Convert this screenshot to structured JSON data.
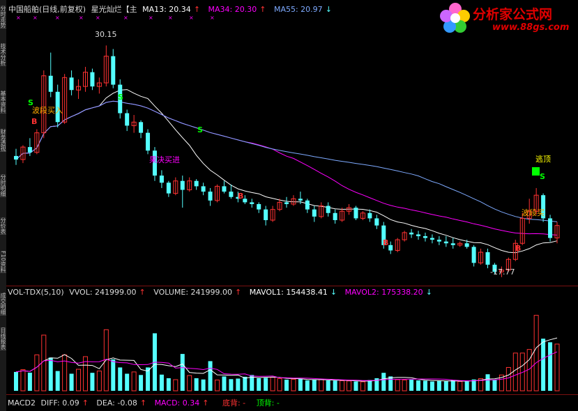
{
  "header": {
    "title": "中国船舶(日线,前复权)",
    "indicator": "星光灿烂【主",
    "ma13": "MA13: 20.34",
    "ma34": "MA34: 20.30",
    "ma55": "MA55: 20.97",
    "ma13_arrow": "↑",
    "ma34_arrow": "↑",
    "ma55_arrow": "↓"
  },
  "sidebar": {
    "tabs": [
      "分时走势",
      "技术分析",
      "基本资料",
      "财务透视",
      "分时明细",
      "分价表",
      "F10资料",
      "成交明细",
      "日线报表"
    ]
  },
  "annotations": {
    "high_price": "30.15",
    "low_price": "-17.77",
    "band_buy_1": "波段买入",
    "decisive_buy": "果决买进",
    "escape_top": "逃顶",
    "band_buy_2": "波段买",
    "s_label": "S",
    "b_label": "B"
  },
  "vol_header": {
    "name": "VOL-TDX(5,10)",
    "vvol": "VVOL: 241999.00",
    "vvol_arrow": "↑",
    "volume": "VOLUME: 241999.00",
    "volume_arrow": "↑",
    "mavol1": "MAVOL1: 154438.41",
    "mavol1_arrow": "↓",
    "mavol2": "MAVOL2: 175338.20",
    "mavol2_arrow": "↓"
  },
  "macd_header": {
    "name": "MACD2",
    "diff": "DIFF: 0.09",
    "diff_arrow": "↑",
    "dea": "DEA: -0.08",
    "dea_arrow": "↑",
    "macd": "MACD: 0.34",
    "macd_arrow": "↑",
    "bottom_div": "底背: -",
    "top_div": "顶背: -"
  },
  "logo": {
    "brand": "分析家公式网",
    "url": "www.88gs.com"
  },
  "colors": {
    "up": "#ff3232",
    "down": "#54ffff",
    "ma13": "#ffffff",
    "ma34": "#ff00ff",
    "ma55": "#7eaaff",
    "accent_yellow": "#ffff00",
    "accent_green": "#00ff00",
    "logo_red": "#e00000"
  },
  "chart_data": {
    "type": "candlestick",
    "price_range": [
      17.0,
      31.5
    ],
    "volume_range": [
      0,
      500000
    ],
    "candles": [
      [
        24.0,
        24.4,
        23.5,
        23.8
      ],
      [
        23.8,
        24.6,
        23.6,
        24.5
      ],
      [
        24.5,
        25.0,
        24.0,
        24.2
      ],
      [
        24.2,
        25.5,
        24.1,
        25.3
      ],
      [
        25.3,
        28.8,
        25.0,
        28.5
      ],
      [
        28.5,
        29.8,
        27.3,
        27.6
      ],
      [
        27.6,
        28.0,
        25.6,
        25.9
      ],
      [
        25.9,
        28.6,
        25.8,
        28.4
      ],
      [
        28.4,
        28.8,
        27.4,
        27.7
      ],
      [
        27.7,
        28.3,
        27.2,
        27.9
      ],
      [
        27.9,
        29.0,
        27.6,
        28.7
      ],
      [
        28.7,
        28.9,
        27.7,
        27.9
      ],
      [
        27.9,
        28.4,
        27.5,
        28.1
      ],
      [
        28.1,
        30.2,
        27.9,
        29.6
      ],
      [
        29.6,
        30.0,
        27.8,
        28.0
      ],
      [
        28.0,
        28.3,
        26.1,
        26.4
      ],
      [
        26.4,
        26.6,
        25.4,
        25.7
      ],
      [
        25.7,
        26.3,
        25.3,
        25.9
      ],
      [
        25.9,
        26.0,
        25.0,
        25.3
      ],
      [
        25.3,
        25.5,
        24.1,
        24.3
      ],
      [
        24.3,
        24.5,
        22.6,
        22.9
      ],
      [
        22.9,
        23.2,
        22.2,
        22.5
      ],
      [
        22.5,
        22.6,
        21.7,
        21.9
      ],
      [
        21.9,
        22.8,
        21.8,
        22.6
      ],
      [
        22.6,
        22.9,
        21.1,
        22.1
      ],
      [
        22.1,
        22.8,
        22.0,
        22.6
      ],
      [
        22.6,
        22.7,
        22.1,
        22.3
      ],
      [
        22.3,
        22.5,
        21.8,
        22.0
      ],
      [
        22.0,
        22.2,
        21.2,
        21.5
      ],
      [
        21.5,
        22.4,
        21.4,
        22.3
      ],
      [
        22.3,
        22.6,
        21.9,
        22.0
      ],
      [
        22.0,
        22.4,
        21.6,
        21.7
      ],
      [
        21.7,
        22.0,
        21.4,
        21.6
      ],
      [
        21.6,
        21.8,
        21.3,
        21.4
      ],
      [
        21.4,
        21.6,
        21.1,
        21.3
      ],
      [
        21.3,
        21.4,
        20.8,
        21.0
      ],
      [
        21.0,
        21.2,
        20.1,
        20.4
      ],
      [
        20.4,
        21.2,
        20.3,
        21.0
      ],
      [
        21.0,
        21.6,
        20.9,
        21.4
      ],
      [
        21.4,
        21.7,
        21.1,
        21.3
      ],
      [
        21.3,
        21.8,
        21.2,
        21.6
      ],
      [
        21.6,
        22.0,
        21.3,
        21.5
      ],
      [
        21.5,
        21.6,
        20.8,
        21.0
      ],
      [
        21.0,
        21.2,
        20.3,
        20.6
      ],
      [
        20.6,
        21.4,
        20.5,
        21.2
      ],
      [
        21.2,
        21.4,
        20.6,
        20.8
      ],
      [
        20.8,
        21.0,
        20.2,
        20.4
      ],
      [
        20.4,
        21.1,
        20.3,
        20.9
      ],
      [
        20.9,
        21.3,
        20.7,
        21.1
      ],
      [
        21.1,
        21.2,
        20.4,
        20.5
      ],
      [
        20.5,
        20.9,
        20.4,
        20.8
      ],
      [
        20.8,
        21.0,
        20.3,
        20.5
      ],
      [
        20.5,
        20.7,
        19.9,
        20.1
      ],
      [
        20.1,
        20.3,
        18.8,
        19.0
      ],
      [
        19.0,
        19.2,
        18.5,
        18.7
      ],
      [
        18.7,
        19.4,
        18.6,
        19.3
      ],
      [
        19.3,
        19.8,
        19.2,
        19.7
      ],
      [
        19.7,
        19.9,
        19.4,
        19.6
      ],
      [
        19.6,
        19.8,
        19.3,
        19.5
      ],
      [
        19.5,
        19.7,
        19.2,
        19.4
      ],
      [
        19.4,
        19.6,
        19.1,
        19.3
      ],
      [
        19.3,
        19.5,
        19.0,
        19.2
      ],
      [
        19.2,
        19.5,
        18.9,
        19.1
      ],
      [
        19.1,
        19.4,
        18.8,
        19.0
      ],
      [
        19.0,
        19.2,
        18.9,
        19.1
      ],
      [
        19.1,
        19.3,
        18.8,
        18.9
      ],
      [
        18.9,
        19.0,
        17.8,
        18.0
      ],
      [
        18.0,
        18.8,
        17.9,
        18.6
      ],
      [
        18.6,
        18.8,
        17.7,
        17.9
      ],
      [
        17.9,
        18.0,
        17.4,
        17.5
      ],
      [
        17.5,
        17.8,
        17.2,
        17.6
      ],
      [
        17.6,
        18.3,
        17.5,
        18.2
      ],
      [
        18.2,
        19.3,
        18.1,
        19.1
      ],
      [
        19.1,
        20.8,
        19.0,
        20.5
      ],
      [
        20.5,
        21.6,
        20.2,
        20.9
      ],
      [
        20.9,
        22.2,
        20.7,
        21.8
      ],
      [
        21.8,
        21.9,
        20.3,
        20.5
      ],
      [
        20.5,
        20.7,
        19.2,
        19.4
      ],
      [
        19.4,
        20.3,
        19.1,
        20.1
      ]
    ],
    "volumes": [
      105000,
      118000,
      101000,
      200000,
      310000,
      185000,
      110000,
      200000,
      95000,
      120000,
      190000,
      100000,
      110000,
      340000,
      175000,
      130000,
      95000,
      105000,
      88000,
      130000,
      320000,
      90000,
      70000,
      62000,
      205000,
      85000,
      70000,
      63000,
      165000,
      60000,
      80000,
      65000,
      68000,
      78000,
      88000,
      70000,
      72000,
      75000,
      68000,
      62000,
      64000,
      66000,
      58000,
      60000,
      62000,
      58000,
      57000,
      56000,
      55000,
      52000,
      50000,
      60000,
      70000,
      100000,
      80000,
      62000,
      60000,
      62000,
      58000,
      56000,
      52000,
      55000,
      53000,
      60000,
      52000,
      52000,
      63000,
      68000,
      92000,
      60000,
      88000,
      130000,
      210000,
      210000,
      230000,
      420000,
      290000,
      270000,
      260000
    ],
    "volume_colors_up": true
  }
}
